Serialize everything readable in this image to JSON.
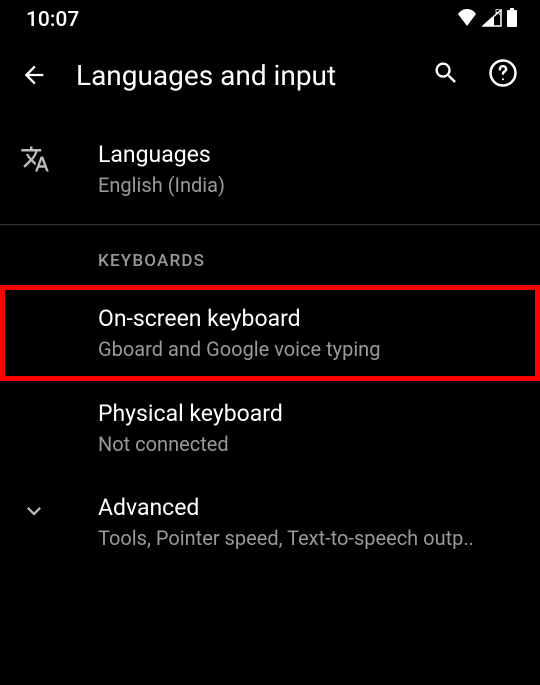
{
  "status": {
    "time": "10:07"
  },
  "header": {
    "title": "Languages and input"
  },
  "items": {
    "languages": {
      "title": "Languages",
      "subtitle": "English (India)"
    },
    "keyboards_header": "KEYBOARDS",
    "onscreen": {
      "title": "On-screen keyboard",
      "subtitle": "Gboard and Google voice typing"
    },
    "physical": {
      "title": "Physical keyboard",
      "subtitle": "Not connected"
    },
    "advanced": {
      "title": "Advanced",
      "subtitle": "Tools, Pointer speed, Text-to-speech outp.."
    }
  }
}
